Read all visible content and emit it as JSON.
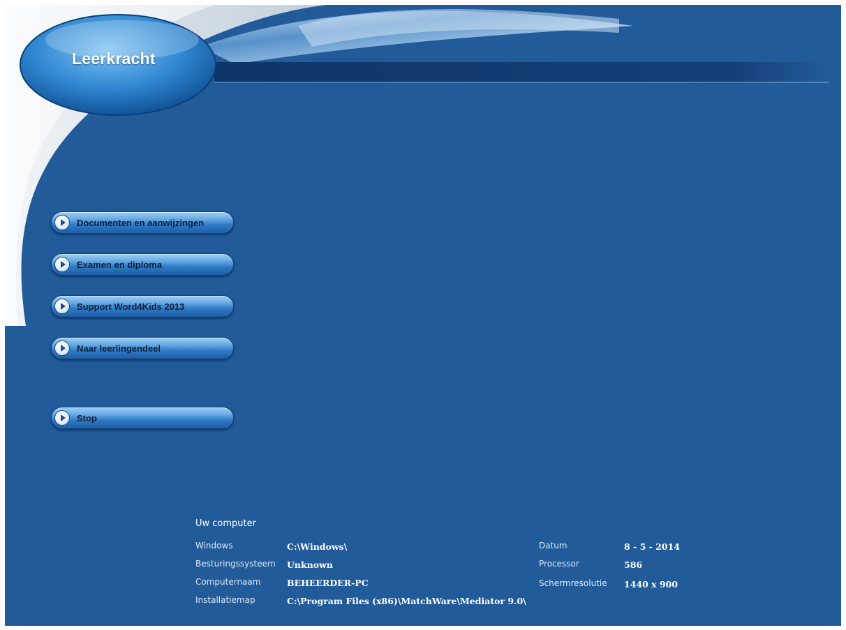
{
  "app": {
    "title": "Leerkracht"
  },
  "menu": {
    "items": [
      {
        "label": "Documenten en aanwijzingen"
      },
      {
        "label": "Examen en diploma"
      },
      {
        "label": "Support Word4Kids 2013"
      },
      {
        "label": "Naar leerlingendeel"
      },
      {
        "label": "Stop"
      }
    ]
  },
  "computer": {
    "heading": "Uw computer",
    "windows_label": "Windows",
    "windows_value": "C:\\Windows\\",
    "os_label": "Besturingssysteem",
    "os_value": "Unknown",
    "name_label": "Computernaam",
    "name_value": "BEHEERDER-PC",
    "install_label": "Installatiemap",
    "install_value": "C:\\Program Files (x86)\\MatchWare\\Mediator 9.0\\",
    "date_label": "Datum",
    "date_value": "8 - 5 - 2014",
    "processor_label": "Processor",
    "processor_value": "586",
    "resolution_label": "Schermresolutie",
    "resolution_value": "1440 x 900"
  },
  "colors": {
    "background": "#225b9a",
    "accent": "#7fc0f0"
  }
}
